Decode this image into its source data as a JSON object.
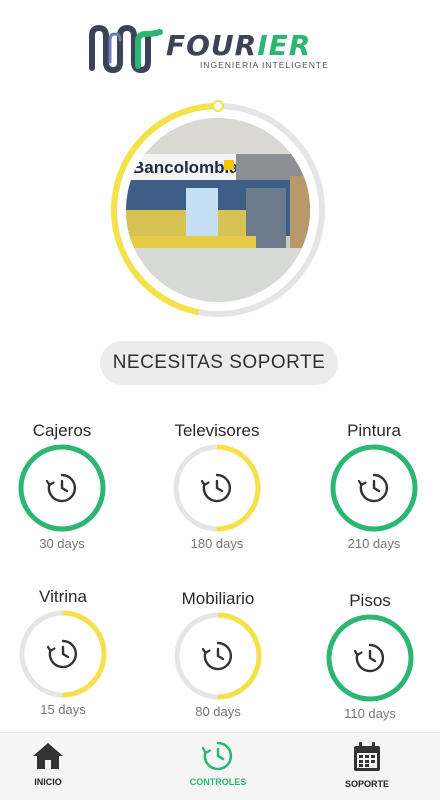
{
  "app": {
    "brand_part1": "FOUR",
    "brand_part2": "IER",
    "tagline": "INGENIERIA INTELIGENTE"
  },
  "hero": {
    "photo_sign": "Bancolombia",
    "progress": 0.47,
    "progress_color": "#f5e14a"
  },
  "support_button": {
    "label": "NECESITAS SOPORTE"
  },
  "items": [
    {
      "title": "Cajeros",
      "days": "30 days",
      "progress": 1.0,
      "color": "#2bb673"
    },
    {
      "title": "Televisores",
      "days": "180 days",
      "progress": 0.5,
      "color": "#f5e14a"
    },
    {
      "title": "Pintura",
      "days": "210 days",
      "progress": 1.0,
      "color": "#2bb673"
    },
    {
      "title": "Vitrina",
      "days": "15 days",
      "progress": 0.5,
      "color": "#f5e14a"
    },
    {
      "title": "Mobiliario",
      "days": "80 days",
      "progress": 0.5,
      "color": "#f5e14a"
    },
    {
      "title": "Pisos",
      "days": "110 days",
      "progress": 1.0,
      "color": "#2bb673"
    }
  ],
  "colors": {
    "accent_green": "#2bb673",
    "accent_yellow": "#f5e14a",
    "track_gray": "#e5e5e5",
    "dark": "#3c4257"
  },
  "nav": {
    "items": [
      {
        "label": "INICIO",
        "icon": "home-icon"
      },
      {
        "label": "CONTROLES",
        "icon": "clock-refresh-icon"
      },
      {
        "label": "SOPORTE",
        "icon": "calendar-icon"
      }
    ],
    "active_index": 1
  }
}
